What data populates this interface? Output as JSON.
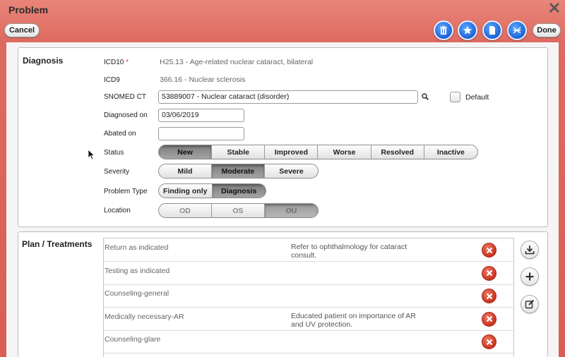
{
  "window": {
    "title": "Problem"
  },
  "toolbar": {
    "cancel_label": "Cancel",
    "done_label": "Done",
    "icons": [
      "trash-icon",
      "star-icon",
      "document-icon",
      "scissors-icon"
    ]
  },
  "diagnosis": {
    "section_title": "Diagnosis",
    "icd10_label": "ICD10",
    "icd10_required_mark": "*",
    "icd10_value": "H25.13 - Age-related nuclear cataract, bilateral",
    "icd9_label": "ICD9",
    "icd9_value": "366.16 - Nuclear sclerosis",
    "snomed_label": "SNOMED CT",
    "snomed_value": "53889007 - Nuclear cataract (disorder)",
    "default_label": "Default",
    "diagnosed_on_label": "Diagnosed on",
    "diagnosed_on_value": "03/06/2019",
    "abated_on_label": "Abated on",
    "abated_on_value": "",
    "status_label": "Status",
    "status_options": [
      "New",
      "Stable",
      "Improved",
      "Worse",
      "Resolved",
      "Inactive"
    ],
    "status_selected": "New",
    "severity_label": "Severity",
    "severity_options": [
      "Mild",
      "Moderate",
      "Severe"
    ],
    "severity_selected": "Moderate",
    "problem_type_label": "Problem Type",
    "problem_type_options": [
      "Finding only",
      "Diagnosis"
    ],
    "problem_type_selected": "Diagnosis",
    "location_label": "Location",
    "location_options": [
      "OD",
      "OS",
      "OU"
    ],
    "location_selected": "OU"
  },
  "plan": {
    "section_title": "Plan / Treatments",
    "rows": [
      {
        "name": "Return as indicated",
        "note": "Refer to ophthalmology for cataract consult."
      },
      {
        "name": "Testing as indicated",
        "note": ""
      },
      {
        "name": "Counseling-general",
        "note": ""
      },
      {
        "name": "Medically necessary-AR",
        "note": "Educated patient on importance of AR and UV protection."
      },
      {
        "name": "Counseling-glare",
        "note": ""
      }
    ],
    "side_icons": [
      "download-icon",
      "plus-icon",
      "edit-icon"
    ]
  },
  "colors": {
    "header_bg": "#dd6a60",
    "accent_blue": "#1e63d6",
    "delete_red": "#c8321f"
  }
}
